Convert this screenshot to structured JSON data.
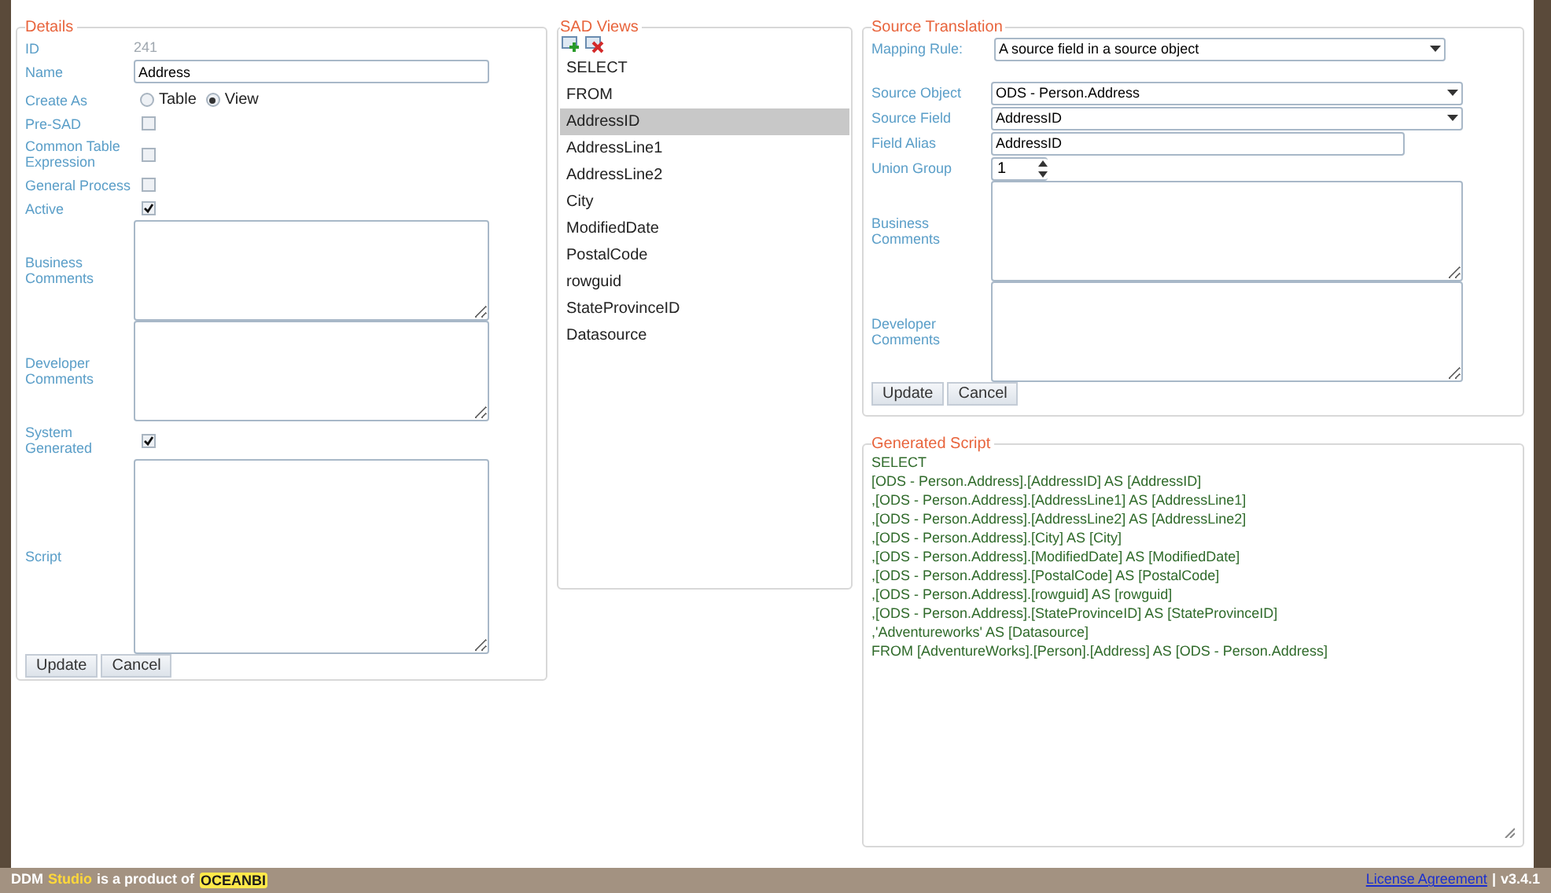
{
  "details": {
    "legend": "Details",
    "rows": [
      {
        "kind": "readonly",
        "label": "ID",
        "value": "241"
      },
      {
        "kind": "input",
        "label": "Name",
        "value": "Address"
      },
      {
        "kind": "radio",
        "label": "Create As",
        "options": [
          {
            "label": "Table",
            "selected": false
          },
          {
            "label": "View",
            "selected": true
          }
        ]
      },
      {
        "kind": "checkbox",
        "label": "Pre-SAD",
        "checked": false
      },
      {
        "kind": "checkbox",
        "label": "Common Table Expression",
        "checked": false
      },
      {
        "kind": "checkbox",
        "label": "General Process",
        "checked": false
      },
      {
        "kind": "checkbox",
        "label": "Active",
        "checked": true
      },
      {
        "kind": "textarea",
        "label": "Business Comments"
      },
      {
        "kind": "textarea",
        "label": "Developer Comments"
      },
      {
        "kind": "checkbox",
        "label": "System Generated",
        "checked": true
      },
      {
        "kind": "textarea",
        "label": "Script",
        "tall": true
      }
    ],
    "buttons": [
      "Update",
      "Cancel"
    ]
  },
  "sad_views": {
    "legend": "SAD Views",
    "items": [
      {
        "label": "SELECT",
        "selected": false
      },
      {
        "label": "FROM",
        "selected": false
      },
      {
        "label": "AddressID",
        "selected": true
      },
      {
        "label": "AddressLine1",
        "selected": false
      },
      {
        "label": "AddressLine2",
        "selected": false
      },
      {
        "label": "City",
        "selected": false
      },
      {
        "label": "ModifiedDate",
        "selected": false
      },
      {
        "label": "PostalCode",
        "selected": false
      },
      {
        "label": "rowguid",
        "selected": false
      },
      {
        "label": "StateProvinceID",
        "selected": false
      },
      {
        "label": "Datasource",
        "selected": false
      }
    ]
  },
  "source_translation": {
    "legend": "Source Translation",
    "rows": [
      {
        "kind": "select",
        "label": "Mapping Rule:",
        "value": "A source field in a source object",
        "narrow": true
      },
      {
        "kind": "spacer"
      },
      {
        "kind": "select",
        "label": "Source Object",
        "value": "ODS - Person.Address"
      },
      {
        "kind": "select",
        "label": "Source Field",
        "value": "AddressID"
      },
      {
        "kind": "input",
        "label": "Field Alias",
        "value": "AddressID"
      },
      {
        "kind": "spinner",
        "label": "Union Group",
        "value": "1"
      },
      {
        "kind": "textarea",
        "label": "Business Comments"
      },
      {
        "kind": "textarea",
        "label": "Developer Comments"
      }
    ],
    "buttons": [
      "Update",
      "Cancel"
    ]
  },
  "generated_script": {
    "legend": "Generated Script",
    "lines": [
      "SELECT",
      "[ODS - Person.Address].[AddressID] AS [AddressID]",
      ",[ODS - Person.Address].[AddressLine1] AS [AddressLine1]",
      ",[ODS - Person.Address].[AddressLine2] AS [AddressLine2]",
      ",[ODS - Person.Address].[City] AS [City]",
      ",[ODS - Person.Address].[ModifiedDate] AS [ModifiedDate]",
      ",[ODS - Person.Address].[PostalCode] AS [PostalCode]",
      ",[ODS - Person.Address].[rowguid] AS [rowguid]",
      ",[ODS - Person.Address].[StateProvinceID] AS [StateProvinceID]",
      ",'Adventureworks' AS [Datasource]",
      "FROM [AdventureWorks].[Person].[Address] AS [ODS - Person.Address]"
    ]
  },
  "footer": {
    "brand": "DDM",
    "brand_highlight": "Studio",
    "tagline": "is a product of",
    "logo": "OCEANBI",
    "link": "License Agreement",
    "separator": "|",
    "version": "v3.4.1"
  }
}
